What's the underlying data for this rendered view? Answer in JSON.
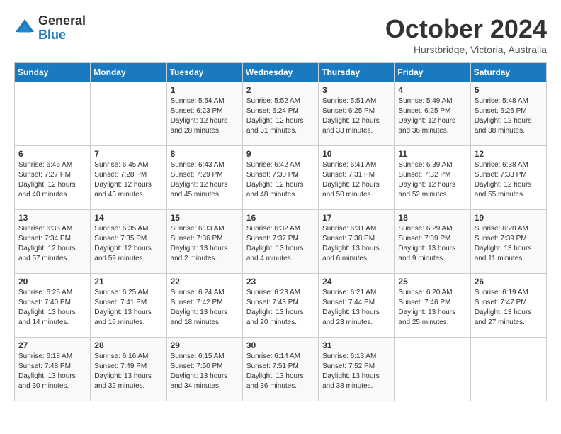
{
  "header": {
    "logo_line1": "General",
    "logo_line2": "Blue",
    "month_title": "October 2024",
    "location": "Hurstbridge, Victoria, Australia"
  },
  "days_of_week": [
    "Sunday",
    "Monday",
    "Tuesday",
    "Wednesday",
    "Thursday",
    "Friday",
    "Saturday"
  ],
  "weeks": [
    [
      {
        "day": "",
        "info": ""
      },
      {
        "day": "",
        "info": ""
      },
      {
        "day": "1",
        "info": "Sunrise: 5:54 AM\nSunset: 6:23 PM\nDaylight: 12 hours\nand 28 minutes."
      },
      {
        "day": "2",
        "info": "Sunrise: 5:52 AM\nSunset: 6:24 PM\nDaylight: 12 hours\nand 31 minutes."
      },
      {
        "day": "3",
        "info": "Sunrise: 5:51 AM\nSunset: 6:25 PM\nDaylight: 12 hours\nand 33 minutes."
      },
      {
        "day": "4",
        "info": "Sunrise: 5:49 AM\nSunset: 6:25 PM\nDaylight: 12 hours\nand 36 minutes."
      },
      {
        "day": "5",
        "info": "Sunrise: 5:48 AM\nSunset: 6:26 PM\nDaylight: 12 hours\nand 38 minutes."
      }
    ],
    [
      {
        "day": "6",
        "info": "Sunrise: 6:46 AM\nSunset: 7:27 PM\nDaylight: 12 hours\nand 40 minutes."
      },
      {
        "day": "7",
        "info": "Sunrise: 6:45 AM\nSunset: 7:28 PM\nDaylight: 12 hours\nand 43 minutes."
      },
      {
        "day": "8",
        "info": "Sunrise: 6:43 AM\nSunset: 7:29 PM\nDaylight: 12 hours\nand 45 minutes."
      },
      {
        "day": "9",
        "info": "Sunrise: 6:42 AM\nSunset: 7:30 PM\nDaylight: 12 hours\nand 48 minutes."
      },
      {
        "day": "10",
        "info": "Sunrise: 6:41 AM\nSunset: 7:31 PM\nDaylight: 12 hours\nand 50 minutes."
      },
      {
        "day": "11",
        "info": "Sunrise: 6:39 AM\nSunset: 7:32 PM\nDaylight: 12 hours\nand 52 minutes."
      },
      {
        "day": "12",
        "info": "Sunrise: 6:38 AM\nSunset: 7:33 PM\nDaylight: 12 hours\nand 55 minutes."
      }
    ],
    [
      {
        "day": "13",
        "info": "Sunrise: 6:36 AM\nSunset: 7:34 PM\nDaylight: 12 hours\nand 57 minutes."
      },
      {
        "day": "14",
        "info": "Sunrise: 6:35 AM\nSunset: 7:35 PM\nDaylight: 12 hours\nand 59 minutes."
      },
      {
        "day": "15",
        "info": "Sunrise: 6:33 AM\nSunset: 7:36 PM\nDaylight: 13 hours\nand 2 minutes."
      },
      {
        "day": "16",
        "info": "Sunrise: 6:32 AM\nSunset: 7:37 PM\nDaylight: 13 hours\nand 4 minutes."
      },
      {
        "day": "17",
        "info": "Sunrise: 6:31 AM\nSunset: 7:38 PM\nDaylight: 13 hours\nand 6 minutes."
      },
      {
        "day": "18",
        "info": "Sunrise: 6:29 AM\nSunset: 7:39 PM\nDaylight: 13 hours\nand 9 minutes."
      },
      {
        "day": "19",
        "info": "Sunrise: 6:28 AM\nSunset: 7:39 PM\nDaylight: 13 hours\nand 11 minutes."
      }
    ],
    [
      {
        "day": "20",
        "info": "Sunrise: 6:26 AM\nSunset: 7:40 PM\nDaylight: 13 hours\nand 14 minutes."
      },
      {
        "day": "21",
        "info": "Sunrise: 6:25 AM\nSunset: 7:41 PM\nDaylight: 13 hours\nand 16 minutes."
      },
      {
        "day": "22",
        "info": "Sunrise: 6:24 AM\nSunset: 7:42 PM\nDaylight: 13 hours\nand 18 minutes."
      },
      {
        "day": "23",
        "info": "Sunrise: 6:23 AM\nSunset: 7:43 PM\nDaylight: 13 hours\nand 20 minutes."
      },
      {
        "day": "24",
        "info": "Sunrise: 6:21 AM\nSunset: 7:44 PM\nDaylight: 13 hours\nand 23 minutes."
      },
      {
        "day": "25",
        "info": "Sunrise: 6:20 AM\nSunset: 7:46 PM\nDaylight: 13 hours\nand 25 minutes."
      },
      {
        "day": "26",
        "info": "Sunrise: 6:19 AM\nSunset: 7:47 PM\nDaylight: 13 hours\nand 27 minutes."
      }
    ],
    [
      {
        "day": "27",
        "info": "Sunrise: 6:18 AM\nSunset: 7:48 PM\nDaylight: 13 hours\nand 30 minutes."
      },
      {
        "day": "28",
        "info": "Sunrise: 6:16 AM\nSunset: 7:49 PM\nDaylight: 13 hours\nand 32 minutes."
      },
      {
        "day": "29",
        "info": "Sunrise: 6:15 AM\nSunset: 7:50 PM\nDaylight: 13 hours\nand 34 minutes."
      },
      {
        "day": "30",
        "info": "Sunrise: 6:14 AM\nSunset: 7:51 PM\nDaylight: 13 hours\nand 36 minutes."
      },
      {
        "day": "31",
        "info": "Sunrise: 6:13 AM\nSunset: 7:52 PM\nDaylight: 13 hours\nand 38 minutes."
      },
      {
        "day": "",
        "info": ""
      },
      {
        "day": "",
        "info": ""
      }
    ]
  ]
}
